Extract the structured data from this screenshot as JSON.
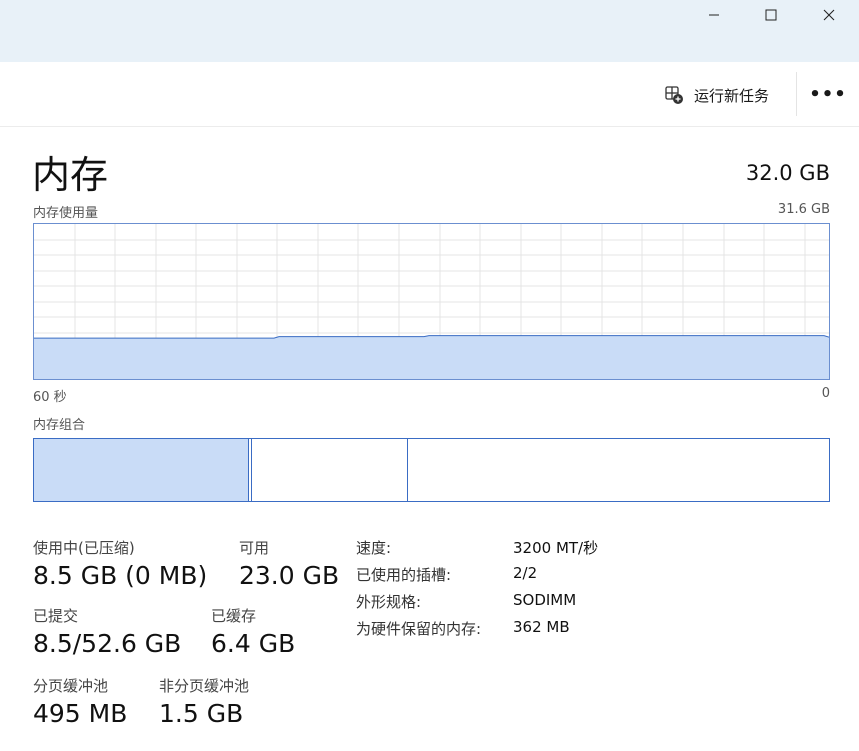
{
  "window": {
    "minimize_icon": "minimize-icon",
    "maximize_icon": "maximize-icon",
    "close_icon": "close-icon"
  },
  "commandbar": {
    "run_new_task_label": "运行新任务",
    "run_new_task_icon": "run-task-icon",
    "more_label": "•••"
  },
  "memory": {
    "title": "内存",
    "total": "32.0 GB",
    "usage_label": "内存使用量",
    "usage_max": "31.6 GB",
    "time_left": "60 秒",
    "time_right": "0",
    "composition_label": "内存组合",
    "usage_fraction": 0.27,
    "composition_fractions": {
      "in_use": 0.27,
      "modified": 0.2,
      "standby": 0.53
    }
  },
  "stats": {
    "in_use_label": "使用中(已压缩)",
    "in_use_value": "8.5 GB (0 MB)",
    "available_label": "可用",
    "available_value": "23.0 GB",
    "committed_label": "已提交",
    "committed_value": "8.5/52.6 GB",
    "cached_label": "已缓存",
    "cached_value": "6.4 GB",
    "paged_pool_label": "分页缓冲池",
    "paged_pool_value": "495 MB",
    "nonpaged_pool_label": "非分页缓冲池",
    "nonpaged_pool_value": "1.5 GB"
  },
  "details": {
    "speed_label": "速度:",
    "speed_value": "3200 MT/秒",
    "slots_label": "已使用的插槽:",
    "slots_value": "2/2",
    "form_factor_label": "外形规格:",
    "form_factor_value": "SODIMM",
    "reserved_label": "为硬件保留的内存:",
    "reserved_value": "362 MB"
  },
  "colors": {
    "titlebar_bg": "#e8f1f8",
    "chart_fill": "#c9dcf7",
    "chart_line": "#3a6cc4",
    "grid": "#e4e4e4"
  }
}
